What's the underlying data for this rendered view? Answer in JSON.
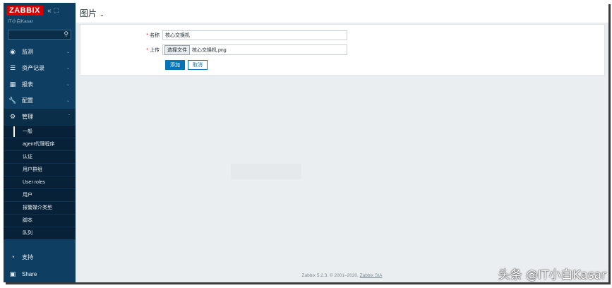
{
  "sidebar": {
    "logo": "ZABBIX",
    "collapse_icon": "«",
    "kiosk_icon": "⛶",
    "server_name": "IT小白Kasar",
    "search": {
      "value": "",
      "placeholder": ""
    },
    "menu": [
      {
        "label": "监测",
        "icon": "eye-icon"
      },
      {
        "label": "资产记录",
        "icon": "list-icon"
      },
      {
        "label": "报表",
        "icon": "report-icon"
      },
      {
        "label": "配置",
        "icon": "wrench-icon"
      },
      {
        "label": "管理",
        "icon": "gear-icon"
      }
    ],
    "admin_submenu": [
      "一般",
      "agent代理程序",
      "认证",
      "用户群组",
      "User roles",
      "用户",
      "报警媒介类型",
      "脚本",
      "队列"
    ],
    "bottom": [
      {
        "label": "支持",
        "icon": "support-icon"
      },
      {
        "label": "Share",
        "icon": "share-icon"
      }
    ]
  },
  "header": {
    "title": "图片"
  },
  "form": {
    "name_label": "名称",
    "name_value": "核心交换机",
    "upload_label": "上传",
    "file_button": "选择文件",
    "file_name": "核心交换机.png",
    "add_button": "添加",
    "cancel_button": "取消"
  },
  "footer": {
    "text": "Zabbix 5.2.3. © 2001–2020, ",
    "link": "Zabbix SIA"
  },
  "watermark": "头条 @IT小白Kasar",
  "colors": {
    "sidebar": "#0e3e61",
    "logo": "#d40000",
    "primary": "#0275b8",
    "background": "#ebeef0"
  }
}
